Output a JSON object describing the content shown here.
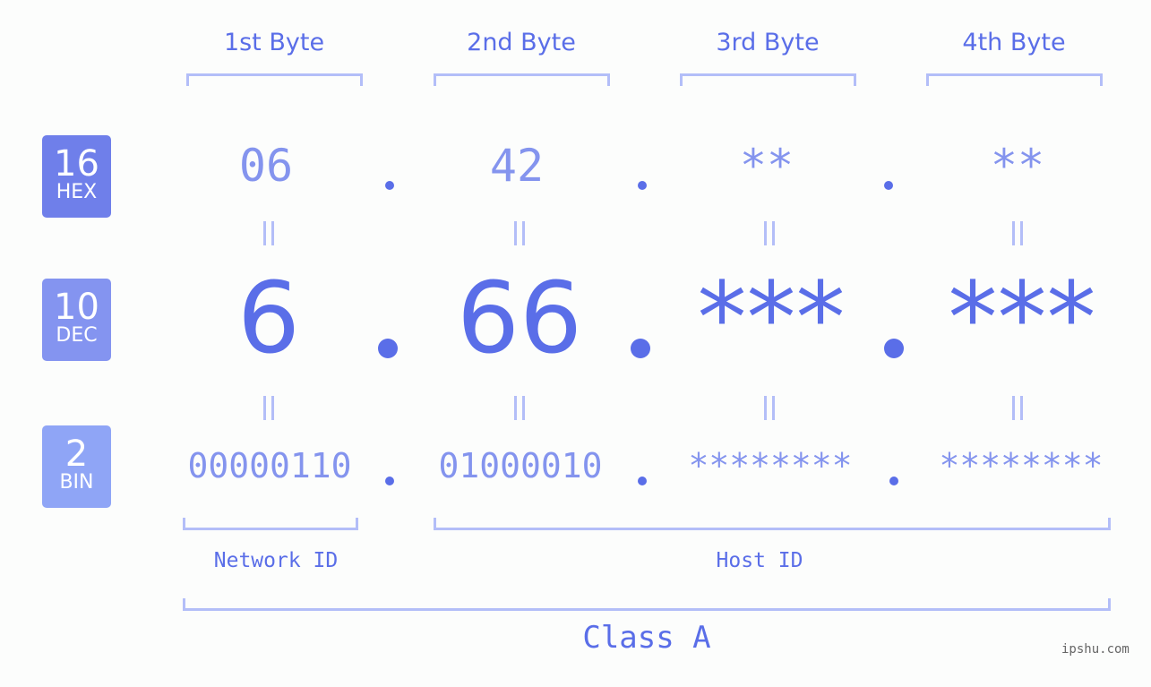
{
  "byte_headers": [
    "1st Byte",
    "2nd Byte",
    "3rd Byte",
    "4th Byte"
  ],
  "badges": [
    {
      "number": "16",
      "base": "HEX",
      "color": "#6f7fea"
    },
    {
      "number": "10",
      "base": "DEC",
      "color": "#8494f0"
    },
    {
      "number": "2",
      "base": "BIN",
      "color": "#8fa5f6"
    }
  ],
  "hex": [
    "06",
    "42",
    "**",
    "**"
  ],
  "dec": [
    "6",
    "66",
    "***",
    "***"
  ],
  "bin": [
    "00000110",
    "01000010",
    "********",
    "********"
  ],
  "sections": {
    "network": "Network ID",
    "host": "Host ID"
  },
  "class_label": "Class A",
  "watermark": "ipshu.com",
  "colors": {
    "primary": "#5a6ee8",
    "light": "#8494ee",
    "bracket": "#b3bef8"
  }
}
